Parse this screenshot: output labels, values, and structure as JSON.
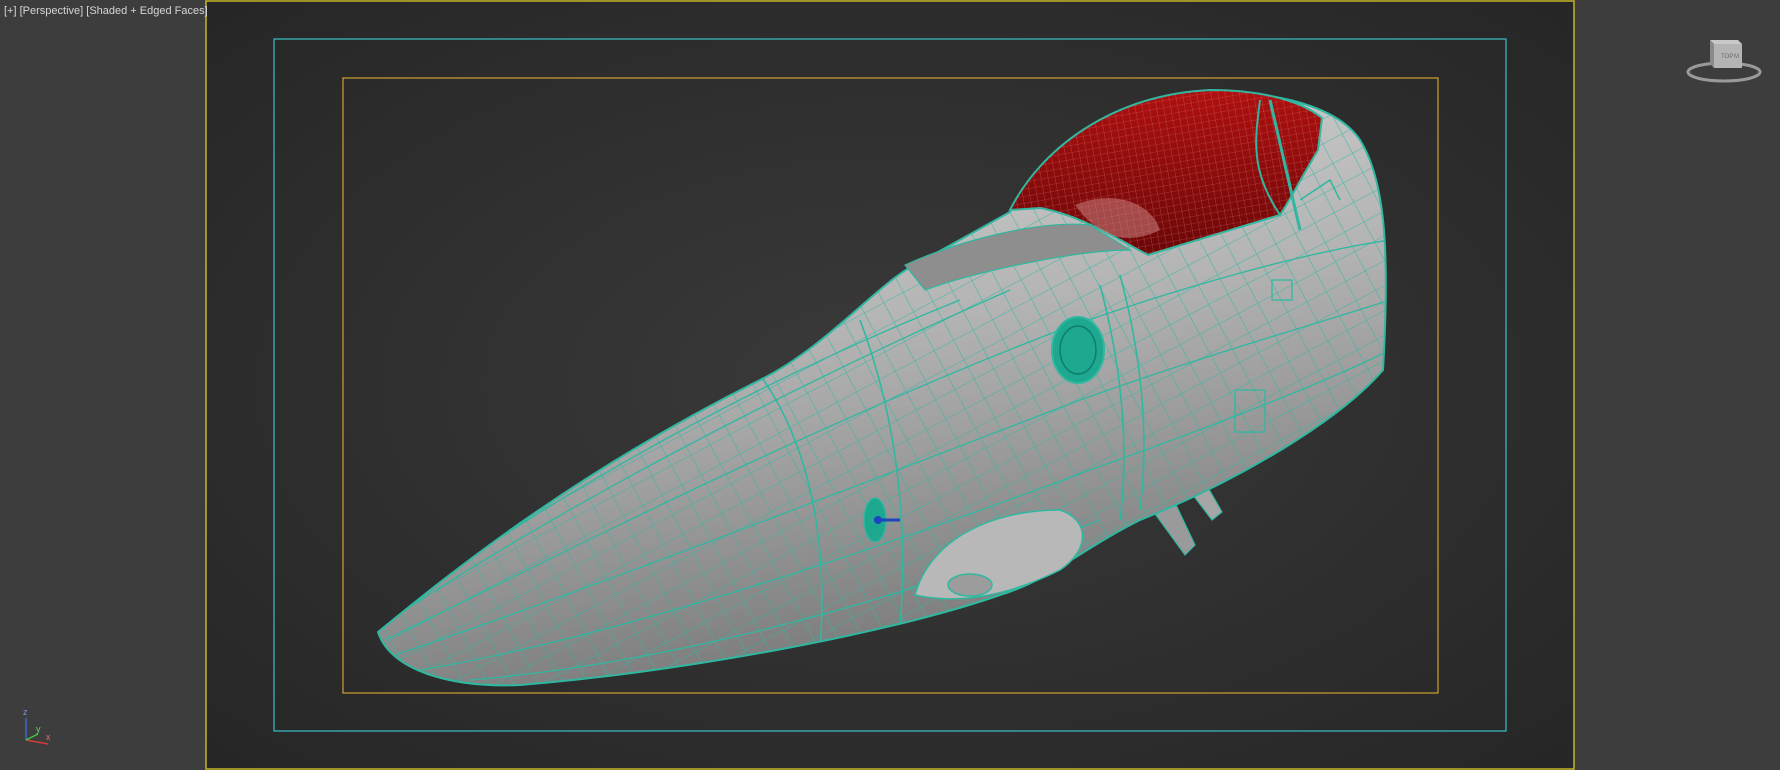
{
  "viewport": {
    "label_plus": "[+]",
    "label_view": "[Perspective]",
    "label_shading": "[Shaded + Edged Faces]",
    "background_color": "#3d3d3d",
    "safe_frame_colors": {
      "live_area": "#c8b428",
      "action_safe": "#38c0c8",
      "title_safe": "#d0a030"
    },
    "wire_color": "#2fb8a0",
    "canopy_color": "#9a0c0c"
  },
  "viewcube": {
    "face_label": "TOP",
    "face_label_back": "M"
  },
  "axis_tripod": {
    "x_label": "x",
    "y_label": "y",
    "z_label": "z",
    "colors": {
      "x": "#d23c3c",
      "y": "#3cc83c",
      "z": "#3c6ad2"
    }
  }
}
